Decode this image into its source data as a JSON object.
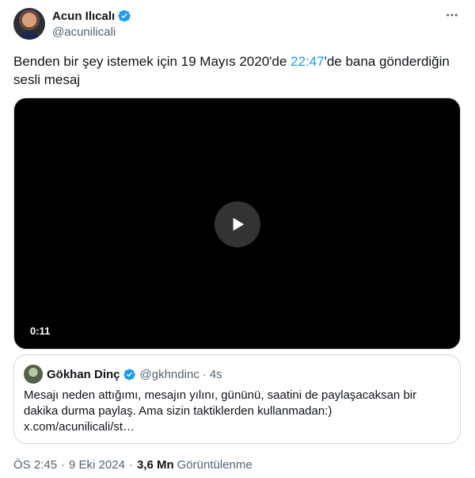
{
  "author": {
    "name": "Acun Ilıcalı",
    "handle": "@acunilicali"
  },
  "tweet": {
    "text_before": "Benden bir şey istemek için 19 Mayıs 2020'de ",
    "link_text": "22:47",
    "text_after": "'de bana gönderdiğin sesli mesaj"
  },
  "video": {
    "duration": "0:11"
  },
  "quote": {
    "name": "Gökhan Dinç",
    "handle": "@gkhndinc",
    "separator": "·",
    "time": "4s",
    "text_line1": "Mesajı neden attığımı, mesajın yılını, gününü, saatini de paylaşacaksan bir",
    "text_line2": "dakika durma paylaş. Ama sizin taktiklerden kullanmadan:)",
    "text_line3": "x.com/acunilicali/st…"
  },
  "meta": {
    "time": "ÖS 2:45",
    "separator1": "·",
    "date": "9 Eki 2024",
    "separator2": "·",
    "views_count": "3,6 Mn",
    "views_label": "Görüntülenme"
  },
  "colors": {
    "accent": "#1d9bf0",
    "text": "#0f1419",
    "muted": "#536471",
    "border": "#cfd9de"
  },
  "icons": {
    "verified": "verified-badge-icon",
    "more": "more-options-icon",
    "play": "play-icon"
  }
}
